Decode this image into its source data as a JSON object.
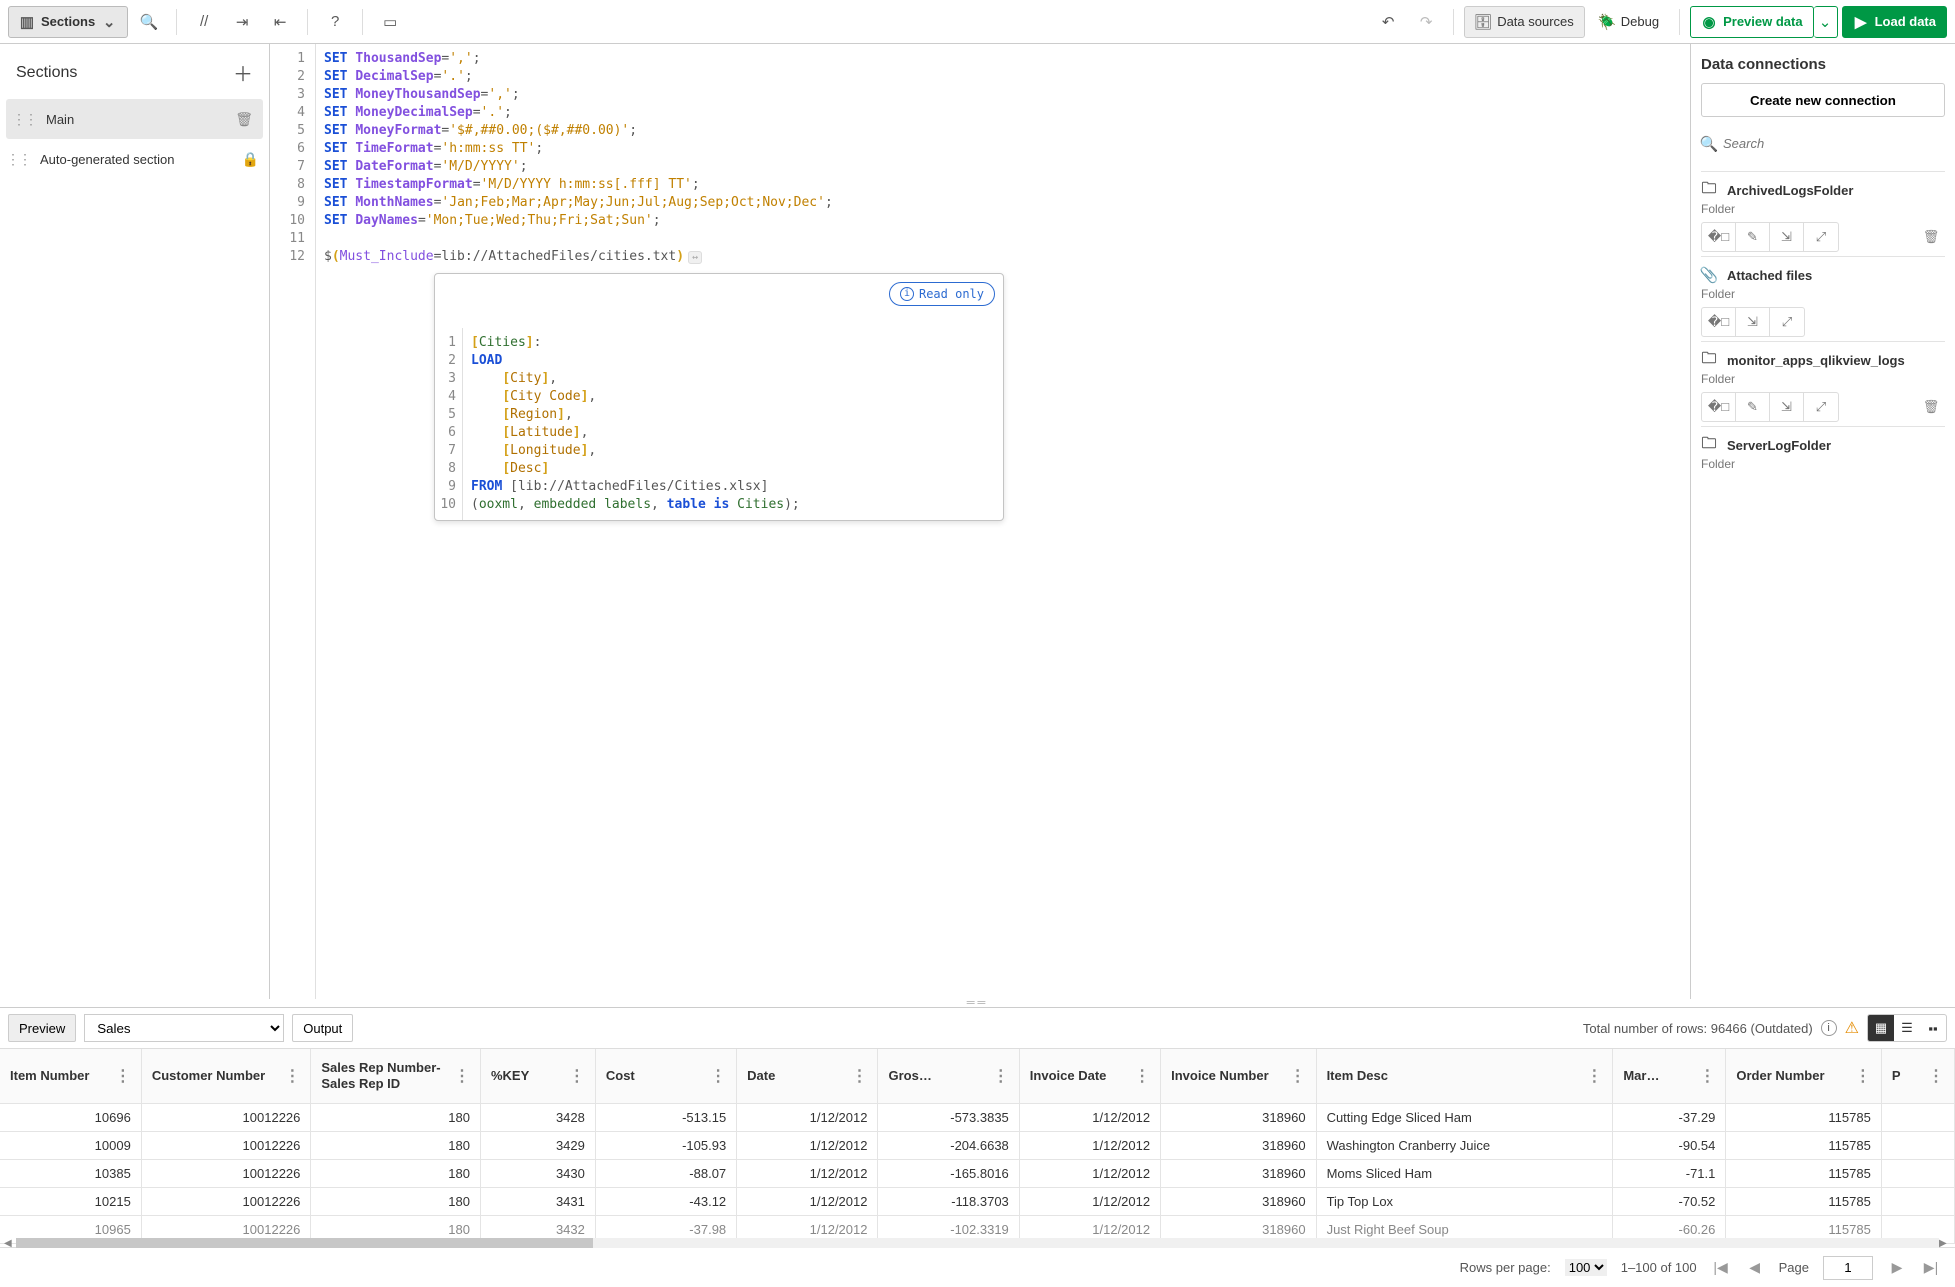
{
  "toolbar": {
    "sections_label": "Sections",
    "data_sources_label": "Data sources",
    "debug_label": "Debug",
    "preview_label": "Preview data",
    "load_label": "Load data"
  },
  "sections_panel": {
    "title": "Sections",
    "items": [
      {
        "label": "Main",
        "active": true,
        "trailing": "delete"
      },
      {
        "label": "Auto-generated section",
        "active": false,
        "trailing": "lock"
      }
    ]
  },
  "editor": {
    "lines": [
      {
        "n": 1,
        "tokens": [
          [
            "kw",
            "SET"
          ],
          [
            "sp",
            " "
          ],
          [
            "var",
            "ThousandSep"
          ],
          [
            "op",
            "="
          ],
          [
            "str",
            "','"
          ],
          [
            "op",
            ";"
          ]
        ]
      },
      {
        "n": 2,
        "tokens": [
          [
            "kw",
            "SET"
          ],
          [
            "sp",
            " "
          ],
          [
            "var",
            "DecimalSep"
          ],
          [
            "op",
            "="
          ],
          [
            "str",
            "'.'"
          ],
          [
            "op",
            ";"
          ]
        ]
      },
      {
        "n": 3,
        "tokens": [
          [
            "kw",
            "SET"
          ],
          [
            "sp",
            " "
          ],
          [
            "var",
            "MoneyThousandSep"
          ],
          [
            "op",
            "="
          ],
          [
            "str",
            "','"
          ],
          [
            "op",
            ";"
          ]
        ]
      },
      {
        "n": 4,
        "tokens": [
          [
            "kw",
            "SET"
          ],
          [
            "sp",
            " "
          ],
          [
            "var",
            "MoneyDecimalSep"
          ],
          [
            "op",
            "="
          ],
          [
            "str",
            "'.'"
          ],
          [
            "op",
            ";"
          ]
        ]
      },
      {
        "n": 5,
        "tokens": [
          [
            "kw",
            "SET"
          ],
          [
            "sp",
            " "
          ],
          [
            "var",
            "MoneyFormat"
          ],
          [
            "op",
            "="
          ],
          [
            "str",
            "'$#,##0.00;($#,##0.00)'"
          ],
          [
            "op",
            ";"
          ]
        ]
      },
      {
        "n": 6,
        "tokens": [
          [
            "kw",
            "SET"
          ],
          [
            "sp",
            " "
          ],
          [
            "var",
            "TimeFormat"
          ],
          [
            "op",
            "="
          ],
          [
            "str",
            "'h:mm:ss TT'"
          ],
          [
            "op",
            ";"
          ]
        ]
      },
      {
        "n": 7,
        "tokens": [
          [
            "kw",
            "SET"
          ],
          [
            "sp",
            " "
          ],
          [
            "var",
            "DateFormat"
          ],
          [
            "op",
            "="
          ],
          [
            "str",
            "'M/D/YYYY'"
          ],
          [
            "op",
            ";"
          ]
        ]
      },
      {
        "n": 8,
        "tokens": [
          [
            "kw",
            "SET"
          ],
          [
            "sp",
            " "
          ],
          [
            "var",
            "TimestampFormat"
          ],
          [
            "op",
            "="
          ],
          [
            "str",
            "'M/D/YYYY h:mm:ss[.fff] TT'"
          ],
          [
            "op",
            ";"
          ]
        ]
      },
      {
        "n": 9,
        "tokens": [
          [
            "kw",
            "SET"
          ],
          [
            "sp",
            " "
          ],
          [
            "var",
            "MonthNames"
          ],
          [
            "op",
            "="
          ],
          [
            "str",
            "'Jan;Feb;Mar;Apr;May;Jun;Jul;Aug;Sep;Oct;Nov;Dec'"
          ],
          [
            "op",
            ";"
          ]
        ]
      },
      {
        "n": 10,
        "tokens": [
          [
            "kw",
            "SET"
          ],
          [
            "sp",
            " "
          ],
          [
            "var",
            "DayNames"
          ],
          [
            "op",
            "="
          ],
          [
            "str",
            "'Mon;Tue;Wed;Thu;Fri;Sat;Sun'"
          ],
          [
            "op",
            ";"
          ]
        ]
      },
      {
        "n": 11,
        "tokens": []
      },
      {
        "n": 12,
        "tokens": [
          [
            "op",
            "$"
          ],
          [
            "br",
            "("
          ],
          [
            "fn",
            "Must_Include"
          ],
          [
            "op",
            "=lib://AttachedFiles/cities.txt"
          ],
          [
            "br",
            ")"
          ],
          [
            "gray",
            "↔"
          ]
        ]
      }
    ],
    "include": {
      "readonly_label": "Read only",
      "lines": [
        {
          "n": 1,
          "tokens": [
            [
              "br",
              "["
            ],
            [
              "id",
              "Cities"
            ],
            [
              "br",
              "]"
            ],
            [
              "op",
              ":"
            ]
          ]
        },
        {
          "n": 2,
          "tokens": [
            [
              "kw",
              "LOAD"
            ]
          ]
        },
        {
          "n": 3,
          "tokens": [
            [
              "sp",
              "    "
            ],
            [
              "br",
              "["
            ],
            [
              "fld",
              "City"
            ],
            [
              "br",
              "]"
            ],
            [
              "op",
              ","
            ]
          ]
        },
        {
          "n": 4,
          "tokens": [
            [
              "sp",
              "    "
            ],
            [
              "br",
              "["
            ],
            [
              "fld",
              "City Code"
            ],
            [
              "br",
              "]"
            ],
            [
              "op",
              ","
            ]
          ]
        },
        {
          "n": 5,
          "tokens": [
            [
              "sp",
              "    "
            ],
            [
              "br",
              "["
            ],
            [
              "fld",
              "Region"
            ],
            [
              "br",
              "]"
            ],
            [
              "op",
              ","
            ]
          ]
        },
        {
          "n": 6,
          "tokens": [
            [
              "sp",
              "    "
            ],
            [
              "br",
              "["
            ],
            [
              "fld",
              "Latitude"
            ],
            [
              "br",
              "]"
            ],
            [
              "op",
              ","
            ]
          ]
        },
        {
          "n": 7,
          "tokens": [
            [
              "sp",
              "    "
            ],
            [
              "br",
              "["
            ],
            [
              "fld",
              "Longitude"
            ],
            [
              "br",
              "]"
            ],
            [
              "op",
              ","
            ]
          ]
        },
        {
          "n": 8,
          "tokens": [
            [
              "sp",
              "    "
            ],
            [
              "br",
              "["
            ],
            [
              "fld",
              "Desc"
            ],
            [
              "br",
              "]"
            ]
          ]
        },
        {
          "n": 9,
          "tokens": [
            [
              "kw",
              "FROM"
            ],
            [
              "sp",
              " "
            ],
            [
              "op",
              "[lib://AttachedFiles/Cities.xlsx]"
            ]
          ]
        },
        {
          "n": 10,
          "tokens": [
            [
              "op",
              "("
            ],
            [
              "id",
              "ooxml"
            ],
            [
              "op",
              ", "
            ],
            [
              "id",
              "embedded labels"
            ],
            [
              "op",
              ", "
            ],
            [
              "kw",
              "table is"
            ],
            [
              "sp",
              " "
            ],
            [
              "id",
              "Cities"
            ],
            [
              "op",
              ");"
            ]
          ]
        }
      ]
    }
  },
  "connections": {
    "title": "Data connections",
    "create_label": "Create new connection",
    "search_placeholder": "Search",
    "items": [
      {
        "name": "ArchivedLogsFolder",
        "type": "Folder",
        "icon": "folder",
        "actions": [
          "select",
          "edit",
          "insert",
          "view"
        ],
        "deletable": true
      },
      {
        "name": "Attached files",
        "type": "Folder",
        "icon": "attach",
        "actions": [
          "select",
          "insert",
          "view"
        ],
        "deletable": false
      },
      {
        "name": "monitor_apps_qlikview_logs",
        "type": "Folder",
        "icon": "folder",
        "actions": [
          "select",
          "edit",
          "insert",
          "view"
        ],
        "deletable": true
      },
      {
        "name": "ServerLogFolder",
        "type": "Folder",
        "icon": "folder",
        "actions": [],
        "deletable": false
      }
    ]
  },
  "preview": {
    "preview_btn": "Preview",
    "table_selected": "Sales",
    "output_btn": "Output",
    "total_rows_label": "Total number of rows: 96466 (Outdated)",
    "columns": [
      "Item Number",
      "Customer Number",
      "Sales Rep Number-Sales Rep ID",
      "%KEY",
      "Cost",
      "Date",
      "Gros…",
      "Invoice Date",
      "Invoice Number",
      "Item Desc",
      "Mar…",
      "Order Number",
      "P"
    ],
    "col_align": [
      "r",
      "r",
      "r",
      "r",
      "r",
      "r",
      "r",
      "r",
      "r",
      "l",
      "r",
      "r",
      "r"
    ],
    "rows": [
      [
        "10696",
        "10012226",
        "180",
        "3428",
        "-513.15",
        "1/12/2012",
        "-573.3835",
        "1/12/2012",
        "318960",
        "Cutting Edge Sliced Ham",
        "-37.29",
        "115785",
        ""
      ],
      [
        "10009",
        "10012226",
        "180",
        "3429",
        "-105.93",
        "1/12/2012",
        "-204.6638",
        "1/12/2012",
        "318960",
        "Washington Cranberry Juice",
        "-90.54",
        "115785",
        ""
      ],
      [
        "10385",
        "10012226",
        "180",
        "3430",
        "-88.07",
        "1/12/2012",
        "-165.8016",
        "1/12/2012",
        "318960",
        "Moms Sliced Ham",
        "-71.1",
        "115785",
        ""
      ],
      [
        "10215",
        "10012226",
        "180",
        "3431",
        "-43.12",
        "1/12/2012",
        "-118.3703",
        "1/12/2012",
        "318960",
        "Tip Top Lox",
        "-70.52",
        "115785",
        ""
      ],
      [
        "10965",
        "10012226",
        "180",
        "3432",
        "-37.98",
        "1/12/2012",
        "-102.3319",
        "1/12/2012",
        "318960",
        "Just Right Beef Soup",
        "-60.26",
        "115785",
        ""
      ]
    ],
    "pager": {
      "rows_per_page_label": "Rows per page:",
      "rows_per_page_value": "100",
      "range_label": "1–100 of 100",
      "page_label": "Page",
      "page_value": "1"
    }
  }
}
